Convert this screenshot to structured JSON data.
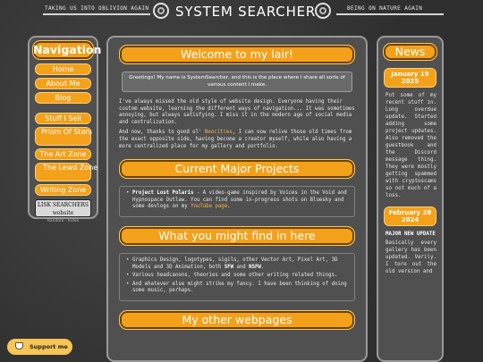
{
  "header": {
    "title": "SYSTEM SEARCHER",
    "left_tagline": "TAKING US INTO OBLIVION AGAIN",
    "right_tagline": "BEING ON NATURE AGAIN"
  },
  "nav": {
    "heading": "Navigation",
    "items": [
      {
        "label": "Home"
      },
      {
        "label": "About Me"
      },
      {
        "label": "Blog"
      },
      {
        "label": "Stuff I Sell"
      },
      {
        "label": "Prism Of Stars"
      },
      {
        "label": "The Art Zone"
      },
      {
        "label": "The Lewd Zone"
      },
      {
        "label": "Writing Zone"
      }
    ],
    "badge_text": "LISK SEARCHERS website",
    "footer_text": "Random · Index"
  },
  "main": {
    "welcome_heading": "Welcome to my lair!",
    "greeting": "Greetings! My name is SystemSearcher, and this is the place where I share all sorts of various content I make.",
    "intro_p1": "I've always missed the old style of website design. Everyone having their custom website, learning the different ways of navigation... It was sometimes annoying, but always satisfying. I miss it in the modern age of social media and centralization.",
    "intro_p2_a": "And now, thanks to good ol' ",
    "intro_p2_link": "Neocities",
    "intro_p2_b": ", I can now relive those old times from the exact opposite side, having become a creator myself, while also having a more centralized place for my gallery and portfolio.",
    "projects_heading": "Current Major Projects",
    "project_name": "Project Lost Polaris",
    "project_desc_a": " - A video-game inspired by Voices in the Void and Hypnospace Outlaw. You can find some in-progress shots on Bluesky and some devlogs on my ",
    "project_desc_link": "YouTube page",
    "project_desc_b": ".",
    "find_heading": "What you might find in here",
    "find_items": [
      {
        "a": "Graphics Design, logotypes, sigils, other Vector Art, Pixel Art, 3D Models and 3D Animation, both ",
        "sfw": "SFW",
        "and": " and ",
        "nsfw": "NSFW",
        "end": "."
      },
      {
        "text": "Various headcanons, theories and some other writing related things."
      },
      {
        "text": "And whatever else might strike my fancy. I have been thinking of doing some music, perhaps."
      }
    ],
    "webpages_heading": "My other webpages"
  },
  "news": {
    "heading": "News",
    "entries": [
      {
        "date": "January 19 2025",
        "text": "Put some of my recent stuff in. Long overdue update. Started adding some project updates. Also removed the guestbook and the Discord message thing. They were mostly getting spammed with cryptoscams so not much of a loss."
      },
      {
        "date": "February 28 2024",
        "title": "MAJOR NEW UPDATE",
        "text": "Basically every gallery has been updated. Verily. I tore out the old version and"
      }
    ]
  },
  "support": {
    "label": "Support me"
  },
  "colors": {
    "accent": "#f3a11b",
    "panel": "#505050",
    "background": "#3a3a3a"
  }
}
